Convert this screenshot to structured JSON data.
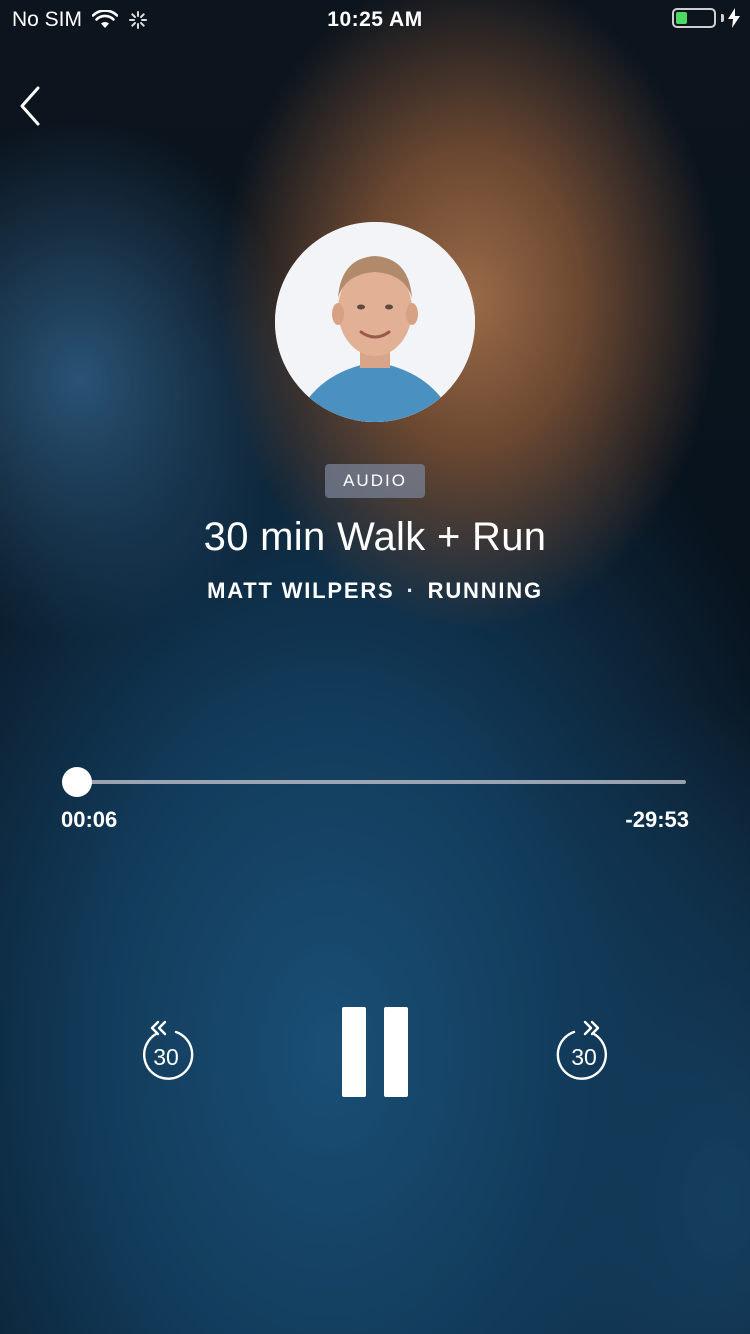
{
  "status_bar": {
    "carrier": "No SIM",
    "time": "10:25 AM"
  },
  "badge": "AUDIO",
  "class_title": "30 min Walk + Run",
  "instructor": "MATT WILPERS",
  "separator": "·",
  "category": "RUNNING",
  "progress": {
    "elapsed": "00:06",
    "remaining": "-29:53",
    "fraction": 0.003
  },
  "controls": {
    "rewind_label": "30",
    "forward_label": "30"
  },
  "colors": {
    "battery_fill": "#4cd964",
    "badge_bg": "#78829a"
  }
}
